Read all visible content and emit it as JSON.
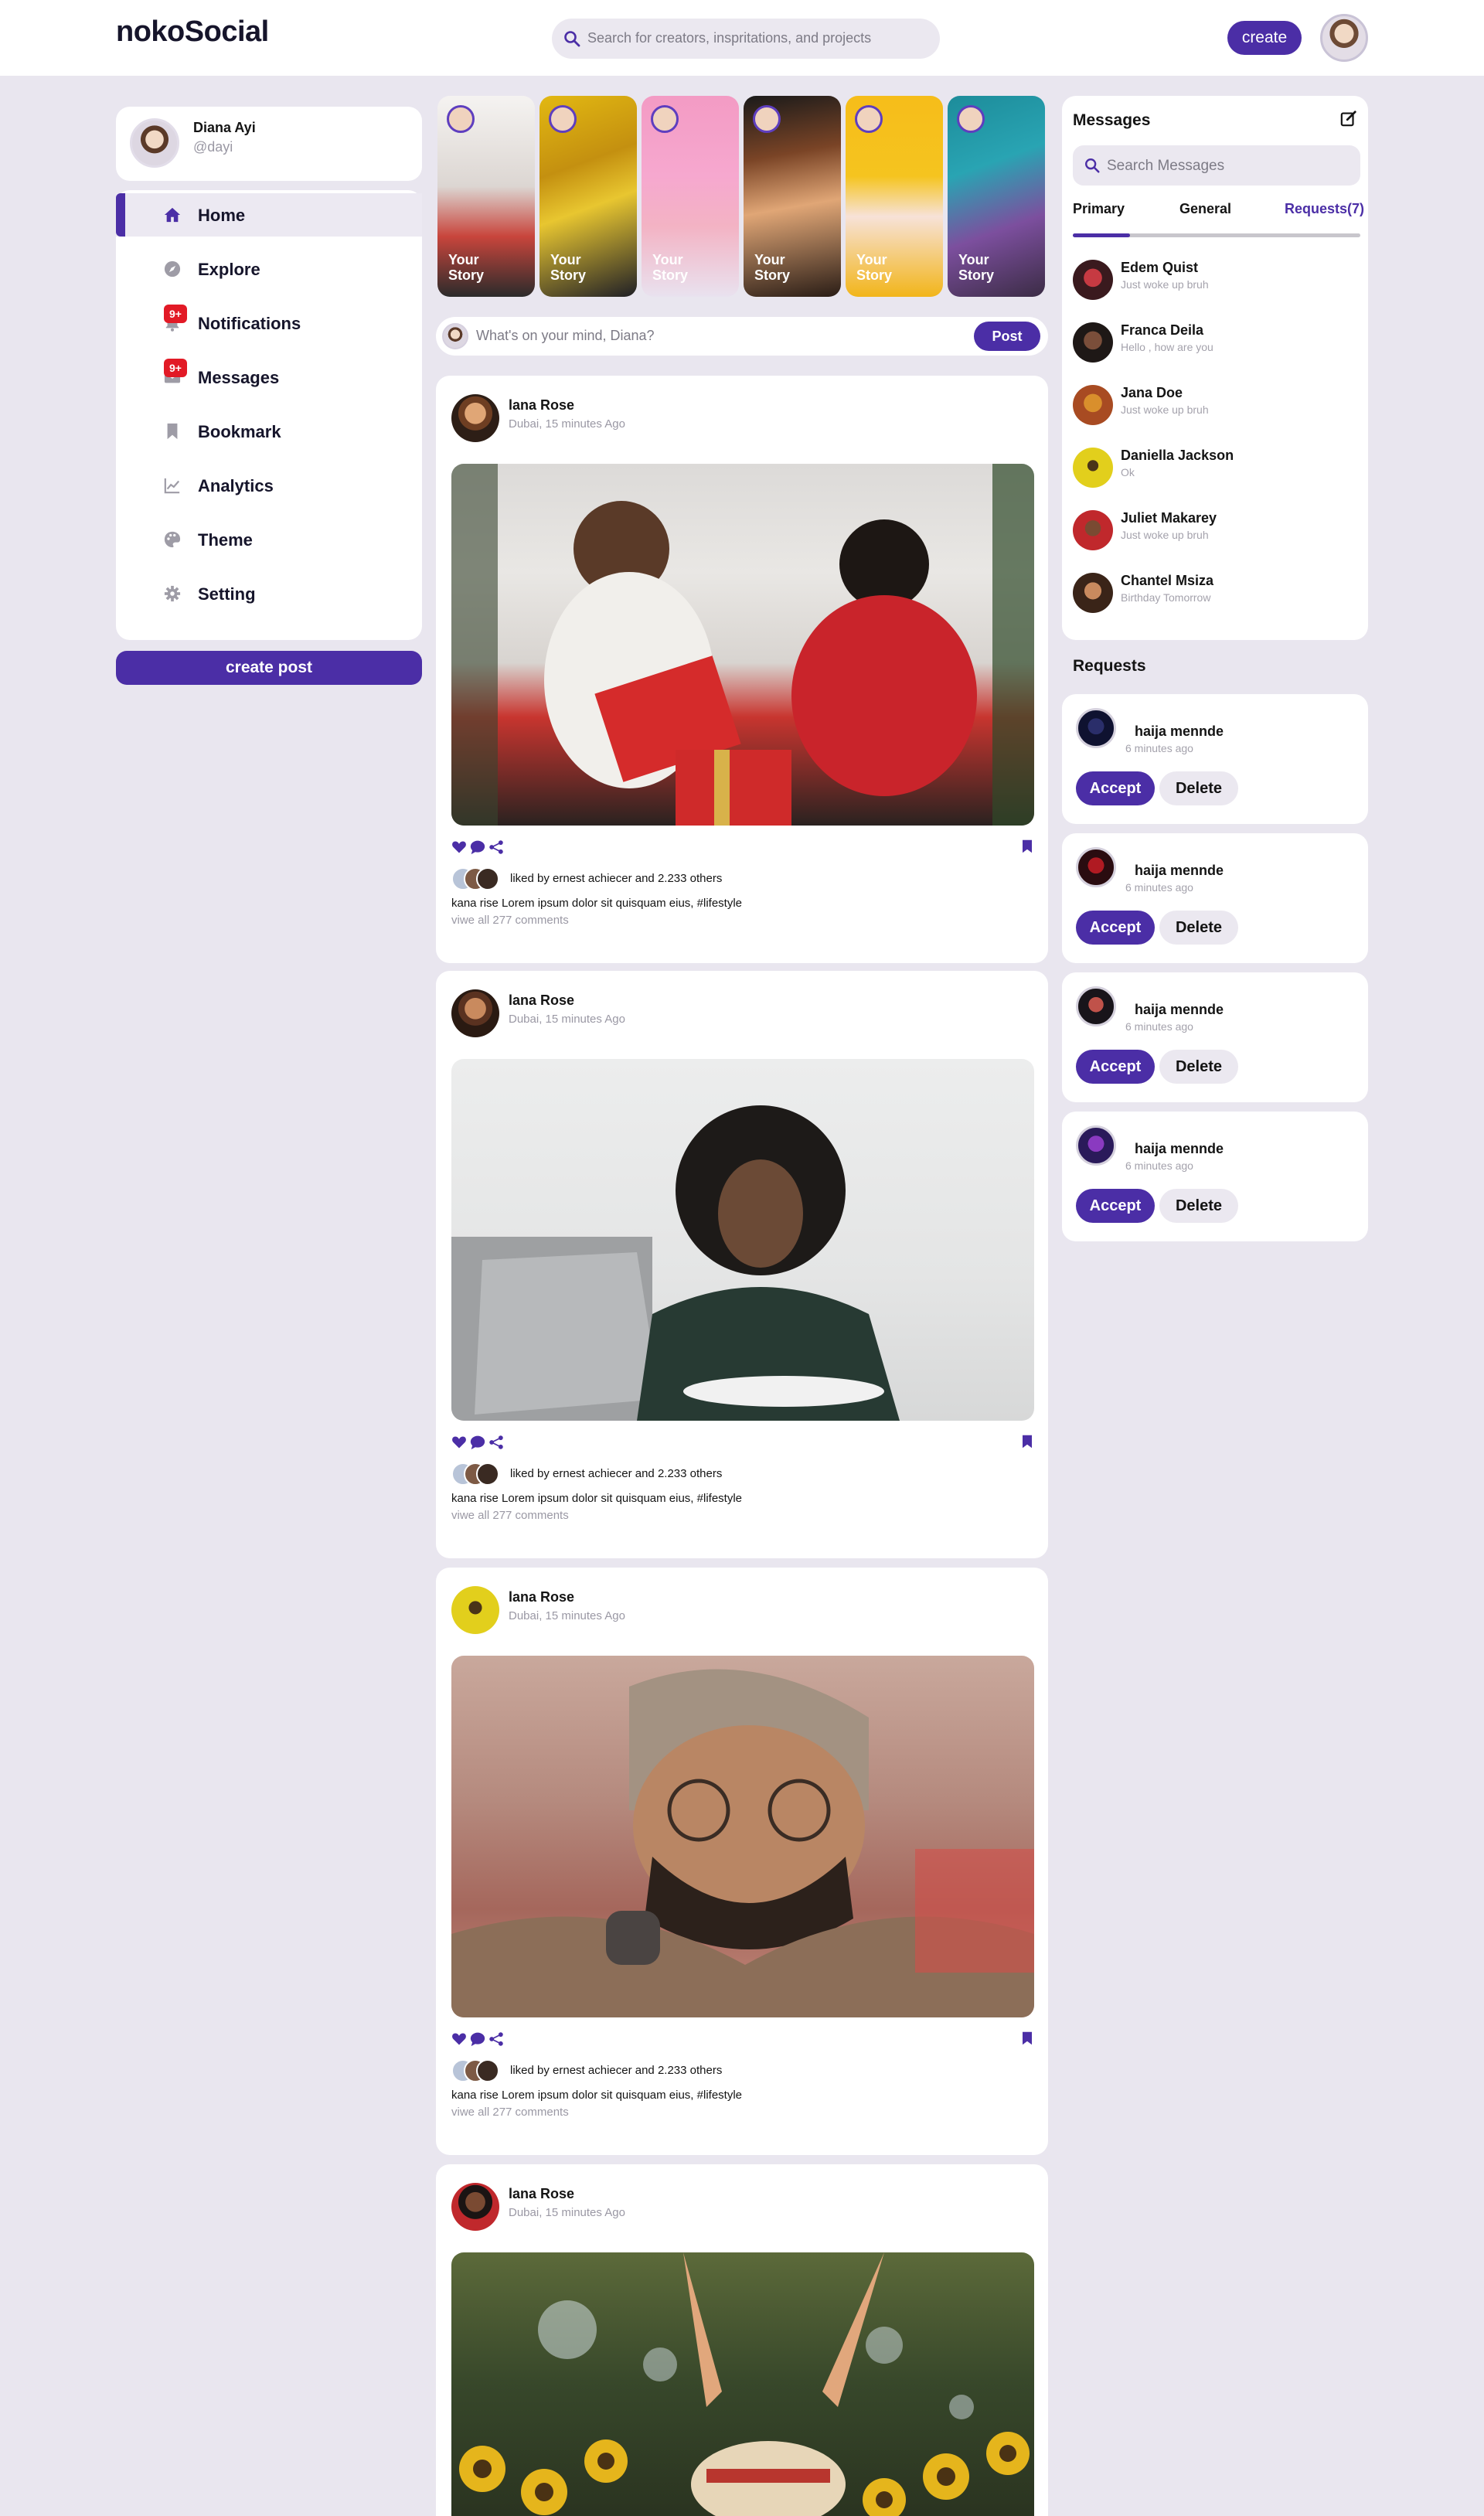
{
  "header": {
    "logo": "nokoSocial",
    "search_placeholder": "Search for creators, inspritations, and projects",
    "create_label": "create"
  },
  "profile": {
    "name": "Diana Ayi",
    "handle": "@dayi"
  },
  "nav": [
    {
      "label": "Home",
      "icon": "home-icon",
      "active": true
    },
    {
      "label": "Explore",
      "icon": "compass-icon"
    },
    {
      "label": "Notifications",
      "icon": "bell-icon",
      "badge": "9+"
    },
    {
      "label": "Messages",
      "icon": "envelope-icon",
      "badge": "9+"
    },
    {
      "label": "Bookmark",
      "icon": "bookmark-icon"
    },
    {
      "label": "Analytics",
      "icon": "chart-line-icon"
    },
    {
      "label": "Theme",
      "icon": "palette-icon"
    },
    {
      "label": "Setting",
      "icon": "gear-icon"
    }
  ],
  "create_post_label": "create post",
  "stories": [
    {
      "label": "Your Story"
    },
    {
      "label": "Your Story"
    },
    {
      "label": "Your Story"
    },
    {
      "label": "Your Story"
    },
    {
      "label": "Your Story"
    },
    {
      "label": "Your Story"
    }
  ],
  "composer": {
    "placeholder": "What's on your mind, Diana?",
    "post_label": "Post"
  },
  "posts": [
    {
      "author": "lana Rose",
      "meta": "Dubai, 15 minutes Ago",
      "liked_by": "liked by ernest achiecer and 2.233 others",
      "caption": "kana rise Lorem ipsum dolor sit quisquam eius, #lifestyle",
      "comments": "viwe all 277 comments"
    },
    {
      "author": "lana Rose",
      "meta": "Dubai, 15 minutes Ago",
      "liked_by": "liked by ernest achiecer and 2.233 others",
      "caption": "kana rise Lorem ipsum dolor sit quisquam eius, #lifestyle",
      "comments": "viwe all 277 comments"
    },
    {
      "author": "lana Rose",
      "meta": "Dubai, 15 minutes Ago",
      "liked_by": "liked by ernest achiecer and 2.233 others",
      "caption": "kana rise Lorem ipsum dolor sit quisquam eius, #lifestyle",
      "comments": "viwe all 277 comments"
    },
    {
      "author": "lana Rose",
      "meta": "Dubai, 15 minutes Ago"
    }
  ],
  "messages": {
    "title": "Messages",
    "search_placeholder": "Search Messages",
    "tabs": [
      "Primary",
      "General",
      "Requests(7)"
    ],
    "items": [
      {
        "name": "Edem Quist",
        "text": "Just woke up bruh"
      },
      {
        "name": "Franca Deila",
        "text": "Hello , how are you"
      },
      {
        "name": "Jana Doe",
        "text": "Just woke up bruh"
      },
      {
        "name": "Daniella Jackson",
        "text": "Ok"
      },
      {
        "name": "Juliet Makarey",
        "text": "Just woke up bruh"
      },
      {
        "name": "Chantel Msiza",
        "text": "Birthday Tomorrow"
      }
    ]
  },
  "requests": {
    "title": "Requests",
    "items": [
      {
        "name": "haija mennde",
        "time": "6 minutes ago"
      },
      {
        "name": "haija mennde",
        "time": "6 minutes ago"
      },
      {
        "name": "haija mennde",
        "time": "6 minutes ago"
      },
      {
        "name": "haija mennde",
        "time": "6 minutes ago"
      }
    ],
    "accept_label": "Accept",
    "delete_label": "Delete"
  },
  "colors": {
    "accent": "#4b2ea6",
    "background": "#e9e6ef",
    "badge": "#e21a26"
  }
}
